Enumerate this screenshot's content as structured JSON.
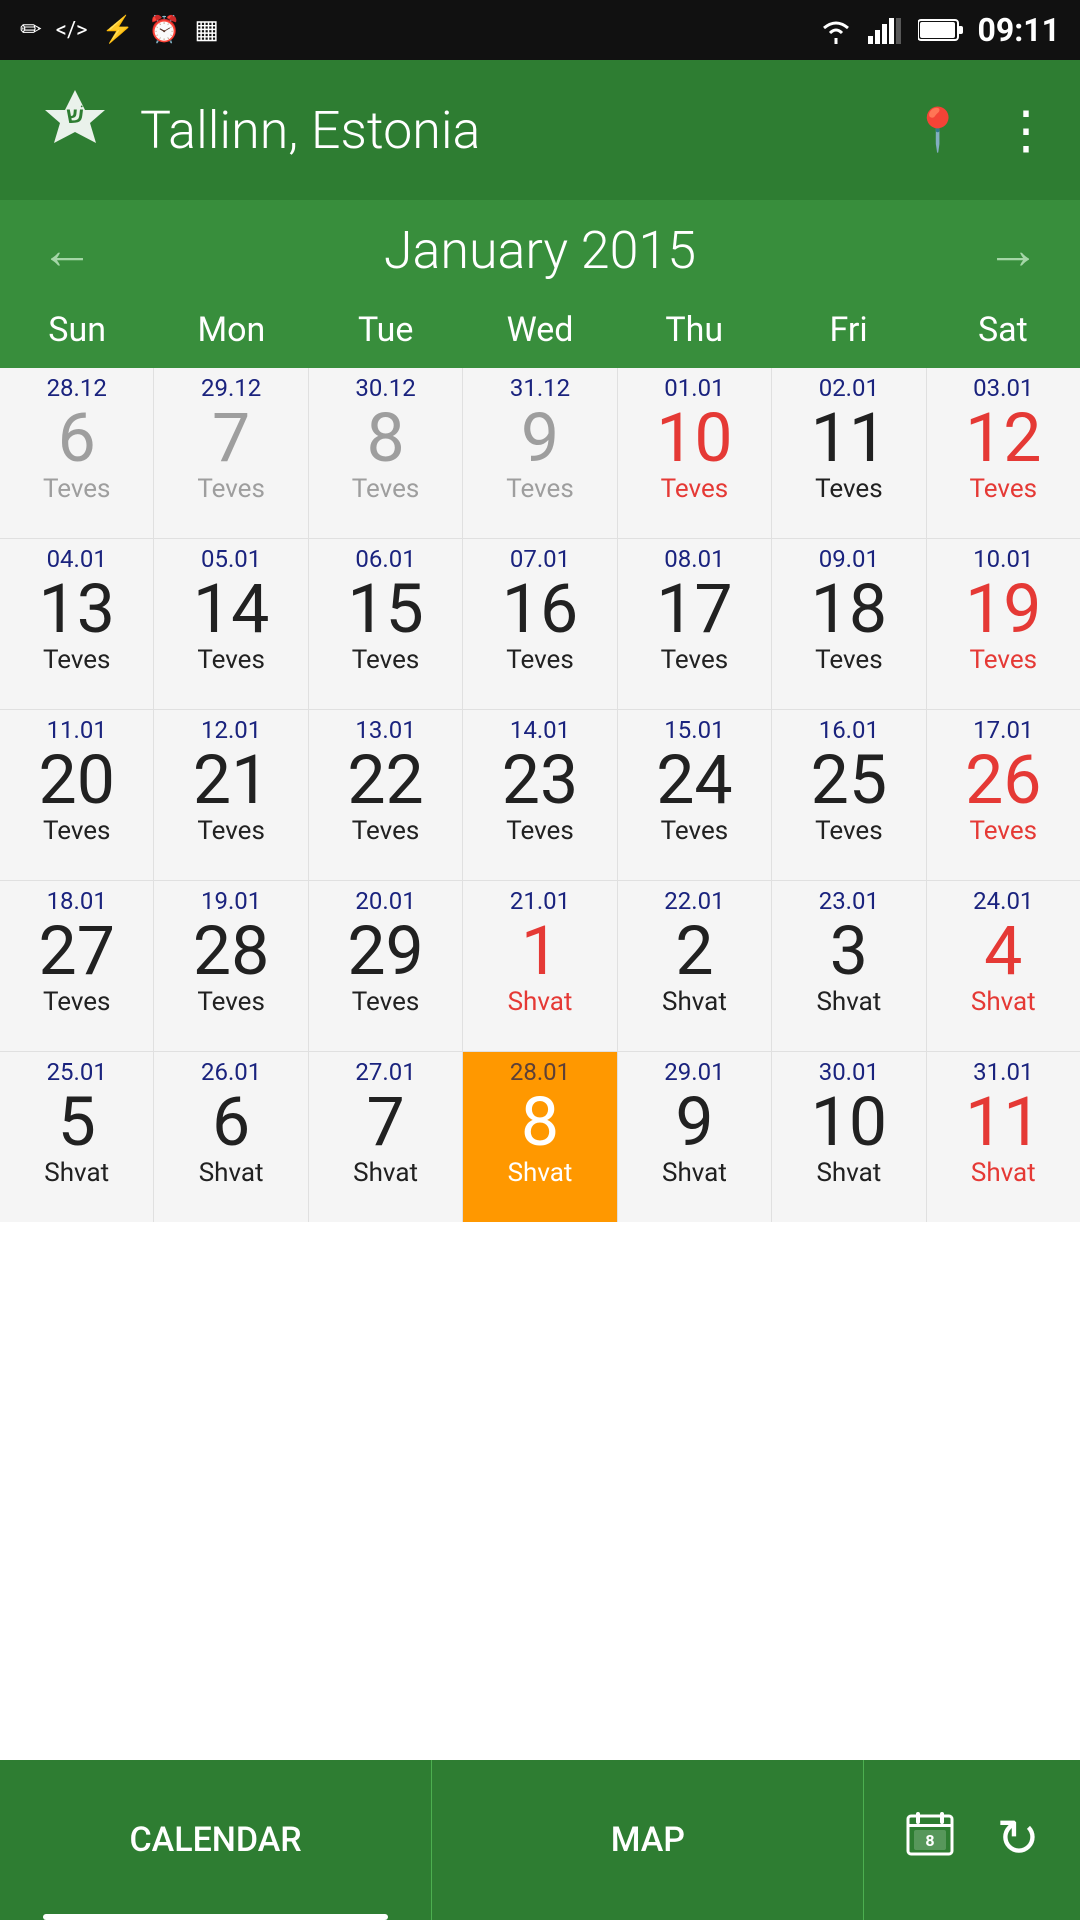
{
  "statusBar": {
    "time": "09:11",
    "leftIcons": [
      "✎",
      "⟨/⟩",
      "⚡",
      "⏰",
      "▦"
    ],
    "rightIcons": [
      "wifi",
      "signal",
      "battery"
    ]
  },
  "header": {
    "appName": "Tallinn, Estonia",
    "locationIcon": "📍",
    "menuIcon": "⋮"
  },
  "monthNav": {
    "title": "January 2015",
    "prevArrow": "←",
    "nextArrow": "→"
  },
  "dayHeaders": [
    "Sun",
    "Mon",
    "Tue",
    "Wed",
    "Thu",
    "Fri",
    "Sat"
  ],
  "weeks": [
    {
      "days": [
        {
          "smallDate": "28.12",
          "num": "6",
          "numColor": "gray",
          "hebrew": "Teves",
          "hebColor": "gray",
          "isToday": false,
          "isPrev": true
        },
        {
          "smallDate": "29.12",
          "num": "7",
          "numColor": "gray",
          "hebrew": "Teves",
          "hebColor": "gray",
          "isToday": false,
          "isPrev": true
        },
        {
          "smallDate": "30.12",
          "num": "8",
          "numColor": "gray",
          "hebrew": "Teves",
          "hebColor": "gray",
          "isToday": false,
          "isPrev": true
        },
        {
          "smallDate": "31.12",
          "num": "9",
          "numColor": "gray",
          "hebrew": "Teves",
          "hebColor": "gray",
          "isToday": false,
          "isPrev": true
        },
        {
          "smallDate": "01.01",
          "num": "10",
          "numColor": "red",
          "hebrew": "Teves",
          "hebColor": "red",
          "isToday": false,
          "isPrev": false
        },
        {
          "smallDate": "02.01",
          "num": "11",
          "numColor": "black",
          "hebrew": "Teves",
          "hebColor": "black",
          "isToday": false,
          "isPrev": false
        },
        {
          "smallDate": "03.01",
          "num": "12",
          "numColor": "red",
          "hebrew": "Teves",
          "hebColor": "red",
          "isToday": false,
          "isPrev": false
        }
      ]
    },
    {
      "days": [
        {
          "smallDate": "04.01",
          "num": "13",
          "numColor": "black",
          "hebrew": "Teves",
          "hebColor": "black",
          "isToday": false,
          "isPrev": false
        },
        {
          "smallDate": "05.01",
          "num": "14",
          "numColor": "black",
          "hebrew": "Teves",
          "hebColor": "black",
          "isToday": false,
          "isPrev": false
        },
        {
          "smallDate": "06.01",
          "num": "15",
          "numColor": "black",
          "hebrew": "Teves",
          "hebColor": "black",
          "isToday": false,
          "isPrev": false
        },
        {
          "smallDate": "07.01",
          "num": "16",
          "numColor": "black",
          "hebrew": "Teves",
          "hebColor": "black",
          "isToday": false,
          "isPrev": false
        },
        {
          "smallDate": "08.01",
          "num": "17",
          "numColor": "black",
          "hebrew": "Teves",
          "hebColor": "black",
          "isToday": false,
          "isPrev": false
        },
        {
          "smallDate": "09.01",
          "num": "18",
          "numColor": "black",
          "hebrew": "Teves",
          "hebColor": "black",
          "isToday": false,
          "isPrev": false
        },
        {
          "smallDate": "10.01",
          "num": "19",
          "numColor": "red",
          "hebrew": "Teves",
          "hebColor": "red",
          "isToday": false,
          "isPrev": false
        }
      ]
    },
    {
      "days": [
        {
          "smallDate": "11.01",
          "num": "20",
          "numColor": "black",
          "hebrew": "Teves",
          "hebColor": "black",
          "isToday": false,
          "isPrev": false
        },
        {
          "smallDate": "12.01",
          "num": "21",
          "numColor": "black",
          "hebrew": "Teves",
          "hebColor": "black",
          "isToday": false,
          "isPrev": false
        },
        {
          "smallDate": "13.01",
          "num": "22",
          "numColor": "black",
          "hebrew": "Teves",
          "hebColor": "black",
          "isToday": false,
          "isPrev": false
        },
        {
          "smallDate": "14.01",
          "num": "23",
          "numColor": "black",
          "hebrew": "Teves",
          "hebColor": "black",
          "isToday": false,
          "isPrev": false
        },
        {
          "smallDate": "15.01",
          "num": "24",
          "numColor": "black",
          "hebrew": "Teves",
          "hebColor": "black",
          "isToday": false,
          "isPrev": false
        },
        {
          "smallDate": "16.01",
          "num": "25",
          "numColor": "black",
          "hebrew": "Teves",
          "hebColor": "black",
          "isToday": false,
          "isPrev": false
        },
        {
          "smallDate": "17.01",
          "num": "26",
          "numColor": "red",
          "hebrew": "Teves",
          "hebColor": "red",
          "isToday": false,
          "isPrev": false
        }
      ]
    },
    {
      "days": [
        {
          "smallDate": "18.01",
          "num": "27",
          "numColor": "black",
          "hebrew": "Teves",
          "hebColor": "black",
          "isToday": false,
          "isPrev": false
        },
        {
          "smallDate": "19.01",
          "num": "28",
          "numColor": "black",
          "hebrew": "Teves",
          "hebColor": "black",
          "isToday": false,
          "isPrev": false
        },
        {
          "smallDate": "20.01",
          "num": "29",
          "numColor": "black",
          "hebrew": "Teves",
          "hebColor": "black",
          "isToday": false,
          "isPrev": false
        },
        {
          "smallDate": "21.01",
          "num": "1",
          "numColor": "red",
          "hebrew": "Shvat",
          "hebColor": "red",
          "isToday": false,
          "isPrev": false
        },
        {
          "smallDate": "22.01",
          "num": "2",
          "numColor": "black",
          "hebrew": "Shvat",
          "hebColor": "black",
          "isToday": false,
          "isPrev": false
        },
        {
          "smallDate": "23.01",
          "num": "3",
          "numColor": "black",
          "hebrew": "Shvat",
          "hebColor": "black",
          "isToday": false,
          "isPrev": false
        },
        {
          "smallDate": "24.01",
          "num": "4",
          "numColor": "red",
          "hebrew": "Shvat",
          "hebColor": "red",
          "isToday": false,
          "isPrev": false
        }
      ]
    },
    {
      "days": [
        {
          "smallDate": "25.01",
          "num": "5",
          "numColor": "black",
          "hebrew": "Shvat",
          "hebColor": "black",
          "isToday": false,
          "isPrev": false
        },
        {
          "smallDate": "26.01",
          "num": "6",
          "numColor": "black",
          "hebrew": "Shvat",
          "hebColor": "black",
          "isToday": false,
          "isPrev": false
        },
        {
          "smallDate": "27.01",
          "num": "7",
          "numColor": "black",
          "hebrew": "Shvat",
          "hebColor": "black",
          "isToday": false,
          "isPrev": false
        },
        {
          "smallDate": "28.01",
          "num": "8",
          "numColor": "red",
          "hebrew": "Shvat",
          "hebColor": "red",
          "isToday": true,
          "isPrev": false
        },
        {
          "smallDate": "29.01",
          "num": "9",
          "numColor": "black",
          "hebrew": "Shvat",
          "hebColor": "black",
          "isToday": false,
          "isPrev": false
        },
        {
          "smallDate": "30.01",
          "num": "10",
          "numColor": "black",
          "hebrew": "Shvat",
          "hebColor": "black",
          "isToday": false,
          "isPrev": false
        },
        {
          "smallDate": "31.01",
          "num": "11",
          "numColor": "red",
          "hebrew": "Shvat",
          "hebColor": "red",
          "isToday": false,
          "isPrev": false
        }
      ]
    }
  ],
  "bottomNav": {
    "tabs": [
      {
        "label": "CALENDAR",
        "active": true
      },
      {
        "label": "MAP",
        "active": false
      }
    ],
    "calendarIcon": "📅",
    "refreshIcon": "↻"
  }
}
